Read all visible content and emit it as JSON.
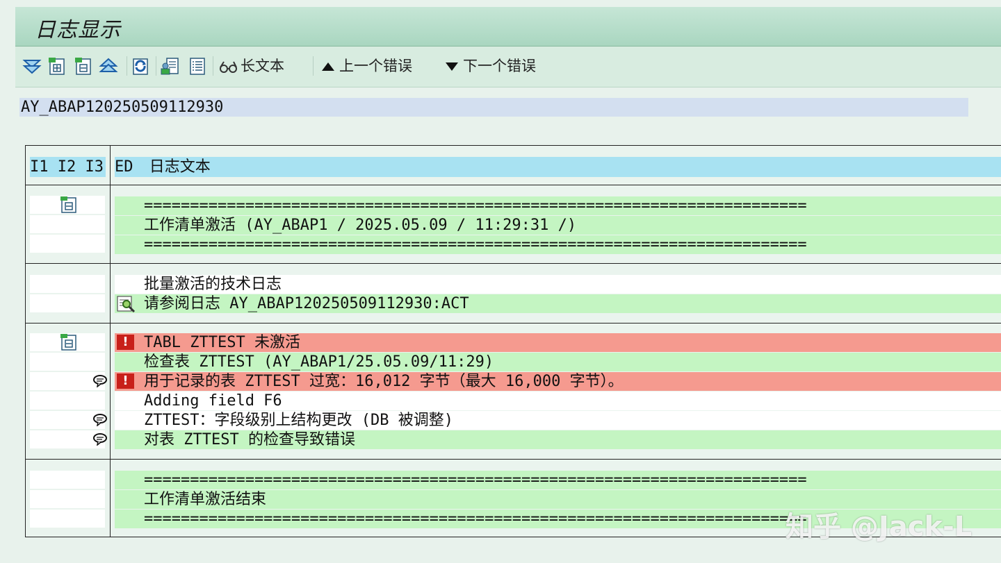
{
  "window": {
    "title": "日志显示"
  },
  "toolbar": {
    "icons": [
      "expand-all-icon",
      "expand-icon",
      "collapse-icon",
      "collapse-all-icon",
      "refresh-icon",
      "details-icon",
      "list-icon"
    ],
    "long_text_label": "长文本",
    "prev_error_label": "上一个错误",
    "next_error_label": "下一个错误"
  },
  "log_id": "AY_ABAP120250509112930",
  "table": {
    "header": {
      "levels": "I1 I2 I3",
      "ed_col": "ED",
      "text_col": "日志文本"
    },
    "groups": [
      {
        "rows": [
          {
            "text": "========================================================================",
            "bg": "green"
          },
          {
            "text": "工作清单激活 (AY_ABAP1 / 2025.05.09 / 11:29:31 /)",
            "bg": "green"
          },
          {
            "text": "========================================================================",
            "bg": "green"
          }
        ]
      },
      {
        "rows": [
          {
            "text": "批量激活的技术日志",
            "bg": "white"
          },
          {
            "text": "请参阅日志 AY_ABAP120250509112930:ACT",
            "bg": "green",
            "icon": "log-detail-icon"
          }
        ]
      },
      {
        "rows": [
          {
            "text": "TABL ZTTEST 未激活",
            "bg": "red",
            "icon": "error-icon"
          },
          {
            "text": "检查表 ZTTEST (AY_ABAP1/25.05.09/11:29)",
            "bg": "green"
          },
          {
            "text": "用于记录的表 ZTTEST 过宽：16,012 字节（最大 16,000 字节）。",
            "bg": "red",
            "icon": "error-icon",
            "level_icon": "message-icon"
          },
          {
            "text": "Adding field F6",
            "bg": "white"
          },
          {
            "text": "ZTTEST：字段级别上结构更改 (DB 被调整)",
            "bg": "white",
            "level_icon": "message-icon"
          },
          {
            "text": "对表 ZTTEST 的检查导致错误",
            "bg": "green",
            "level_icon": "message-icon"
          }
        ]
      },
      {
        "rows": [
          {
            "text": "========================================================================",
            "bg": "green"
          },
          {
            "text": "工作清单激活结束",
            "bg": "green"
          },
          {
            "text": "========================================================================",
            "bg": "green"
          }
        ]
      }
    ],
    "error_mark": "!"
  },
  "watermark": "知乎 @Jack-L"
}
